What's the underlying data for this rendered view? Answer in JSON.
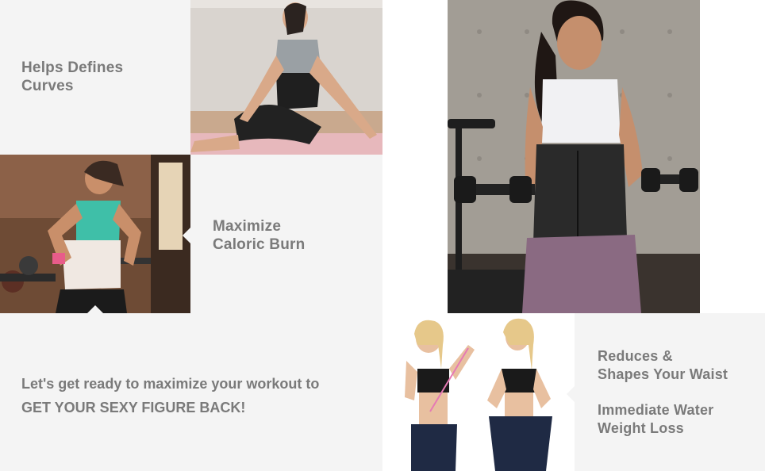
{
  "captions": {
    "curves": [
      "Helps Defines",
      "Curves"
    ],
    "caloric": [
      "Maximize",
      "Caloric Burn"
    ],
    "waist": [
      "Reduces &",
      "Shapes Your Waist"
    ],
    "water": [
      "Immediate Water",
      "Weight Loss"
    ]
  },
  "tagline": {
    "line1": "Let's get ready to maximize your workout to",
    "line2": "GET YOUR SEXY FIGURE BACK!"
  },
  "colors": {
    "panel": "#f4f4f4",
    "caption_text": "#7a7a7a",
    "trainer": "#2a2a2a"
  }
}
